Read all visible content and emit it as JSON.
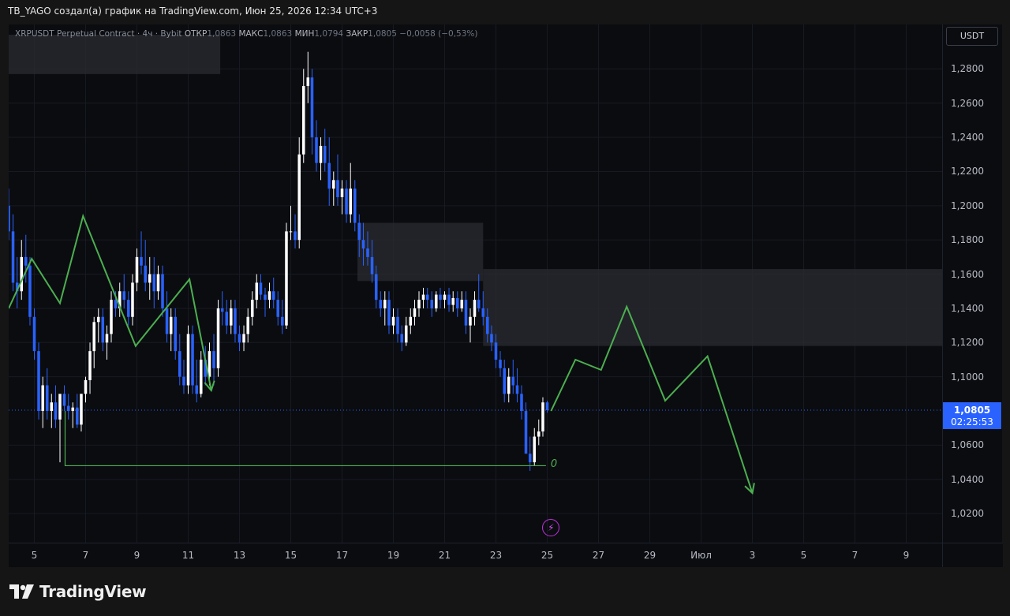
{
  "header": {
    "title": "TB_YAGO создал(а) график на TradingView.com, Июн 25, 2026 12:34 UTC+3"
  },
  "legend": {
    "symbol": "XRPUSDT Perpetual Contract · 4ч · Bybit",
    "open_label": "ОТКР",
    "open": "1,0863",
    "high_label": "МАКС",
    "high": "1,0863",
    "low_label": "МИН",
    "low": "1,0794",
    "close_label": "ЗАКР",
    "close": "1,0805",
    "change": "−0,0058 (−0,53%)"
  },
  "price_axis": {
    "currency": "USDT",
    "last_price": "1,0805",
    "countdown": "02:25:53"
  },
  "brand": {
    "name": "TradingView"
  },
  "annotations": {
    "zero_label": "0",
    "bolt_icon": "lightning-icon"
  },
  "colors": {
    "up": "#ffffff",
    "down": "#2962ff",
    "projection": "#4caf50",
    "zone": "#2a2b30",
    "last_price": "#2962ff"
  },
  "chart_data": {
    "type": "candlestick",
    "title": "XRPUSDT Perpetual Contract · 4ч · Bybit",
    "ylim": [
      1.003,
      1.306
    ],
    "xlim": [
      4.0,
      40.4
    ],
    "y_ticks": [
      {
        "v": 1.28,
        "label": "1,2800"
      },
      {
        "v": 1.26,
        "label": "1,2600"
      },
      {
        "v": 1.24,
        "label": "1,2400"
      },
      {
        "v": 1.22,
        "label": "1,2200"
      },
      {
        "v": 1.2,
        "label": "1,2000"
      },
      {
        "v": 1.18,
        "label": "1,1800"
      },
      {
        "v": 1.16,
        "label": "1,1600"
      },
      {
        "v": 1.14,
        "label": "1,1400"
      },
      {
        "v": 1.12,
        "label": "1,1200"
      },
      {
        "v": 1.1,
        "label": "1,1000"
      },
      {
        "v": 1.06,
        "label": "1,0600"
      },
      {
        "v": 1.04,
        "label": "1,0400"
      },
      {
        "v": 1.02,
        "label": "1,0200"
      }
    ],
    "x_ticks": [
      {
        "v": 5,
        "label": "5"
      },
      {
        "v": 7,
        "label": "7"
      },
      {
        "v": 9,
        "label": "9"
      },
      {
        "v": 11,
        "label": "11"
      },
      {
        "v": 13,
        "label": "13"
      },
      {
        "v": 15,
        "label": "15"
      },
      {
        "v": 17,
        "label": "17"
      },
      {
        "v": 19,
        "label": "19"
      },
      {
        "v": 21,
        "label": "21"
      },
      {
        "v": 23,
        "label": "23"
      },
      {
        "v": 25,
        "label": "25"
      },
      {
        "v": 27,
        "label": "27"
      },
      {
        "v": 29,
        "label": "29"
      },
      {
        "v": 31,
        "label": "Июл"
      },
      {
        "v": 33,
        "label": "3"
      },
      {
        "v": 35,
        "label": "5"
      },
      {
        "v": 37,
        "label": "7"
      },
      {
        "v": 39,
        "label": "9"
      }
    ],
    "last_price": 1.0805,
    "candles": [
      [
        4.0,
        1.2,
        1.21,
        1.18,
        1.185
      ],
      [
        4.17,
        1.185,
        1.195,
        1.15,
        1.155
      ],
      [
        4.33,
        1.155,
        1.17,
        1.14,
        1.15
      ],
      [
        4.5,
        1.15,
        1.18,
        1.145,
        1.17
      ],
      [
        4.67,
        1.17,
        1.183,
        1.155,
        1.165
      ],
      [
        4.83,
        1.165,
        1.17,
        1.13,
        1.135
      ],
      [
        5.0,
        1.135,
        1.14,
        1.11,
        1.115
      ],
      [
        5.17,
        1.115,
        1.12,
        1.075,
        1.08
      ],
      [
        5.33,
        1.08,
        1.1,
        1.07,
        1.095
      ],
      [
        5.5,
        1.095,
        1.105,
        1.075,
        1.08
      ],
      [
        5.67,
        1.08,
        1.09,
        1.07,
        1.085
      ],
      [
        5.83,
        1.085,
        1.095,
        1.07,
        1.075
      ],
      [
        6.0,
        1.075,
        1.085,
        1.05,
        1.09
      ],
      [
        6.17,
        1.09,
        1.095,
        1.08,
        1.083
      ],
      [
        6.33,
        1.083,
        1.09,
        1.075,
        1.08
      ],
      [
        6.5,
        1.08,
        1.085,
        1.07,
        1.082
      ],
      [
        6.67,
        1.082,
        1.09,
        1.07,
        1.072
      ],
      [
        6.83,
        1.072,
        1.09,
        1.068,
        1.09
      ],
      [
        7.0,
        1.09,
        1.1,
        1.085,
        1.098
      ],
      [
        7.17,
        1.098,
        1.12,
        1.09,
        1.115
      ],
      [
        7.33,
        1.115,
        1.135,
        1.105,
        1.132
      ],
      [
        7.5,
        1.132,
        1.14,
        1.12,
        1.135
      ],
      [
        7.67,
        1.135,
        1.14,
        1.115,
        1.12
      ],
      [
        7.83,
        1.12,
        1.13,
        1.11,
        1.125
      ],
      [
        8.0,
        1.125,
        1.15,
        1.12,
        1.145
      ],
      [
        8.17,
        1.145,
        1.15,
        1.135,
        1.14
      ],
      [
        8.33,
        1.14,
        1.155,
        1.135,
        1.15
      ],
      [
        8.5,
        1.15,
        1.16,
        1.14,
        1.145
      ],
      [
        8.67,
        1.145,
        1.15,
        1.13,
        1.135
      ],
      [
        8.83,
        1.135,
        1.16,
        1.13,
        1.155
      ],
      [
        9.0,
        1.155,
        1.175,
        1.15,
        1.17
      ],
      [
        9.17,
        1.17,
        1.185,
        1.16,
        1.165
      ],
      [
        9.33,
        1.165,
        1.18,
        1.15,
        1.155
      ],
      [
        9.5,
        1.155,
        1.17,
        1.145,
        1.16
      ],
      [
        9.67,
        1.16,
        1.17,
        1.14,
        1.15
      ],
      [
        9.83,
        1.15,
        1.165,
        1.145,
        1.16
      ],
      [
        10.0,
        1.16,
        1.165,
        1.135,
        1.14
      ],
      [
        10.17,
        1.14,
        1.15,
        1.12,
        1.125
      ],
      [
        10.33,
        1.125,
        1.14,
        1.115,
        1.135
      ],
      [
        10.5,
        1.135,
        1.14,
        1.11,
        1.115
      ],
      [
        10.67,
        1.115,
        1.125,
        1.095,
        1.1
      ],
      [
        10.83,
        1.1,
        1.11,
        1.09,
        1.095
      ],
      [
        11.0,
        1.095,
        1.13,
        1.09,
        1.125
      ],
      [
        11.17,
        1.125,
        1.13,
        1.09,
        1.095
      ],
      [
        11.33,
        1.095,
        1.11,
        1.085,
        1.09
      ],
      [
        11.5,
        1.09,
        1.115,
        1.088,
        1.11
      ],
      [
        11.67,
        1.11,
        1.118,
        1.095,
        1.1
      ],
      [
        11.83,
        1.1,
        1.12,
        1.095,
        1.115
      ],
      [
        12.0,
        1.115,
        1.125,
        1.095,
        1.105
      ],
      [
        12.17,
        1.105,
        1.145,
        1.1,
        1.14
      ],
      [
        12.33,
        1.14,
        1.15,
        1.13,
        1.138
      ],
      [
        12.5,
        1.138,
        1.145,
        1.125,
        1.13
      ],
      [
        12.67,
        1.13,
        1.145,
        1.125,
        1.14
      ],
      [
        12.83,
        1.14,
        1.145,
        1.12,
        1.125
      ],
      [
        13.0,
        1.125,
        1.13,
        1.115,
        1.12
      ],
      [
        13.17,
        1.12,
        1.13,
        1.115,
        1.125
      ],
      [
        13.33,
        1.125,
        1.14,
        1.12,
        1.135
      ],
      [
        13.5,
        1.135,
        1.15,
        1.13,
        1.145
      ],
      [
        13.67,
        1.145,
        1.16,
        1.14,
        1.155
      ],
      [
        13.83,
        1.155,
        1.16,
        1.145,
        1.148
      ],
      [
        14.0,
        1.148,
        1.152,
        1.135,
        1.145
      ],
      [
        14.17,
        1.145,
        1.155,
        1.14,
        1.15
      ],
      [
        14.33,
        1.15,
        1.158,
        1.14,
        1.145
      ],
      [
        14.5,
        1.145,
        1.15,
        1.13,
        1.135
      ],
      [
        14.67,
        1.135,
        1.145,
        1.125,
        1.13
      ],
      [
        14.83,
        1.13,
        1.19,
        1.128,
        1.185
      ],
      [
        15.0,
        1.185,
        1.2,
        1.18,
        1.185
      ],
      [
        15.17,
        1.185,
        1.195,
        1.175,
        1.18
      ],
      [
        15.33,
        1.18,
        1.24,
        1.175,
        1.23
      ],
      [
        15.5,
        1.23,
        1.28,
        1.225,
        1.27
      ],
      [
        15.67,
        1.27,
        1.29,
        1.26,
        1.275
      ],
      [
        15.83,
        1.275,
        1.28,
        1.23,
        1.24
      ],
      [
        16.0,
        1.24,
        1.25,
        1.22,
        1.225
      ],
      [
        16.17,
        1.225,
        1.24,
        1.215,
        1.235
      ],
      [
        16.33,
        1.235,
        1.245,
        1.22,
        1.225
      ],
      [
        16.5,
        1.225,
        1.24,
        1.2,
        1.21
      ],
      [
        16.67,
        1.21,
        1.22,
        1.2,
        1.215
      ],
      [
        16.83,
        1.215,
        1.23,
        1.2,
        1.205
      ],
      [
        17.0,
        1.205,
        1.215,
        1.195,
        1.21
      ],
      [
        17.17,
        1.21,
        1.215,
        1.19,
        1.195
      ],
      [
        17.33,
        1.195,
        1.225,
        1.19,
        1.21
      ],
      [
        17.5,
        1.21,
        1.215,
        1.185,
        1.19
      ],
      [
        17.67,
        1.19,
        1.195,
        1.17,
        1.18
      ],
      [
        17.83,
        1.18,
        1.19,
        1.165,
        1.175
      ],
      [
        18.0,
        1.175,
        1.185,
        1.165,
        1.17
      ],
      [
        18.17,
        1.17,
        1.18,
        1.155,
        1.16
      ],
      [
        18.33,
        1.16,
        1.165,
        1.14,
        1.145
      ],
      [
        18.5,
        1.145,
        1.15,
        1.135,
        1.14
      ],
      [
        18.67,
        1.14,
        1.15,
        1.13,
        1.145
      ],
      [
        18.83,
        1.145,
        1.15,
        1.125,
        1.13
      ],
      [
        19.0,
        1.13,
        1.14,
        1.125,
        1.135
      ],
      [
        19.17,
        1.135,
        1.14,
        1.12,
        1.125
      ],
      [
        19.33,
        1.125,
        1.13,
        1.115,
        1.12
      ],
      [
        19.5,
        1.12,
        1.135,
        1.118,
        1.13
      ],
      [
        19.67,
        1.13,
        1.14,
        1.125,
        1.135
      ],
      [
        19.83,
        1.135,
        1.145,
        1.13,
        1.14
      ],
      [
        20.0,
        1.14,
        1.15,
        1.135,
        1.145
      ],
      [
        20.17,
        1.145,
        1.152,
        1.14,
        1.148
      ],
      [
        20.33,
        1.148,
        1.152,
        1.14,
        1.145
      ],
      [
        20.5,
        1.145,
        1.15,
        1.135,
        1.14
      ],
      [
        20.67,
        1.14,
        1.15,
        1.138,
        1.148
      ],
      [
        20.83,
        1.148,
        1.152,
        1.14,
        1.145
      ],
      [
        21.0,
        1.145,
        1.15,
        1.14,
        1.148
      ],
      [
        21.17,
        1.148,
        1.152,
        1.138,
        1.142
      ],
      [
        21.33,
        1.142,
        1.15,
        1.138,
        1.146
      ],
      [
        21.5,
        1.146,
        1.15,
        1.135,
        1.14
      ],
      [
        21.67,
        1.14,
        1.15,
        1.138,
        1.145
      ],
      [
        21.83,
        1.145,
        1.15,
        1.125,
        1.13
      ],
      [
        22.0,
        1.13,
        1.14,
        1.12,
        1.135
      ],
      [
        22.17,
        1.135,
        1.15,
        1.13,
        1.145
      ],
      [
        22.33,
        1.145,
        1.16,
        1.138,
        1.14
      ],
      [
        22.5,
        1.14,
        1.15,
        1.13,
        1.135
      ],
      [
        22.67,
        1.135,
        1.14,
        1.12,
        1.125
      ],
      [
        22.83,
        1.125,
        1.13,
        1.115,
        1.12
      ],
      [
        23.0,
        1.12,
        1.125,
        1.105,
        1.11
      ],
      [
        23.17,
        1.11,
        1.115,
        1.1,
        1.105
      ],
      [
        23.33,
        1.105,
        1.11,
        1.085,
        1.09
      ],
      [
        23.5,
        1.09,
        1.105,
        1.085,
        1.1
      ],
      [
        23.67,
        1.1,
        1.11,
        1.09,
        1.095
      ],
      [
        23.83,
        1.095,
        1.105,
        1.085,
        1.09
      ],
      [
        24.0,
        1.09,
        1.095,
        1.075,
        1.08
      ],
      [
        24.17,
        1.08,
        1.085,
        1.06,
        1.055
      ],
      [
        24.33,
        1.055,
        1.065,
        1.045,
        1.05
      ],
      [
        24.5,
        1.05,
        1.07,
        1.048,
        1.065
      ],
      [
        24.67,
        1.065,
        1.075,
        1.06,
        1.068
      ],
      [
        24.83,
        1.068,
        1.088,
        1.065,
        1.085
      ],
      [
        25.0,
        1.085,
        1.086,
        1.079,
        1.0805
      ]
    ],
    "zones": [
      {
        "x0": 4.0,
        "x1": 12.25,
        "y0": 1.277,
        "y1": 1.3
      },
      {
        "x0": 17.6,
        "x1": 22.5,
        "y0": 1.156,
        "y1": 1.19
      },
      {
        "x0": 22.5,
        "x1": 40.4,
        "y0": 1.118,
        "y1": 1.163
      }
    ],
    "projection_top": [
      [
        4.0,
        1.14
      ],
      [
        4.9,
        1.169
      ],
      [
        6.0,
        1.143
      ],
      [
        6.9,
        1.194
      ],
      [
        8.95,
        1.118
      ],
      [
        11.05,
        1.157
      ],
      [
        11.9,
        1.092
      ]
    ],
    "projection_bottom": [
      [
        25.15,
        1.08
      ],
      [
        26.1,
        1.11
      ],
      [
        27.1,
        1.104
      ],
      [
        28.1,
        1.141
      ],
      [
        29.6,
        1.086
      ],
      [
        31.25,
        1.112
      ],
      [
        33.0,
        1.032
      ]
    ],
    "support_line": {
      "x0": 6.2,
      "x1": 24.95,
      "y": 1.048,
      "x_top": 6.2,
      "y_top": 1.08
    }
  }
}
